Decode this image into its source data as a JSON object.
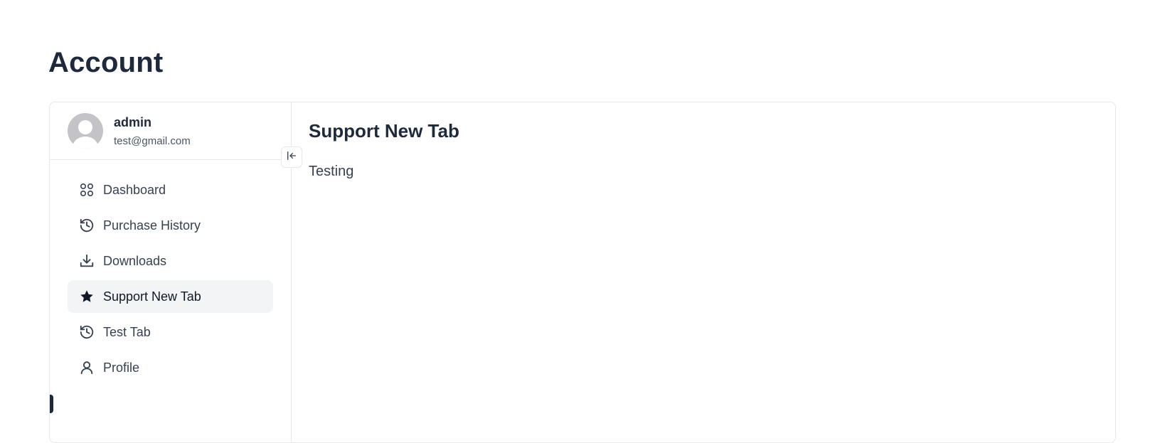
{
  "page": {
    "title": "Account"
  },
  "user": {
    "name": "admin",
    "email": "test@gmail.com"
  },
  "sidebar": {
    "collapse_icon": "collapse-left-icon",
    "items": [
      {
        "label": "Dashboard",
        "icon": "grid-icon",
        "active": false
      },
      {
        "label": "Purchase History",
        "icon": "history-icon",
        "active": false
      },
      {
        "label": "Downloads",
        "icon": "download-icon",
        "active": false
      },
      {
        "label": "Support New Tab",
        "icon": "star-icon",
        "active": true
      },
      {
        "label": "Test Tab",
        "icon": "history-icon",
        "active": false
      },
      {
        "label": "Profile",
        "icon": "user-icon",
        "active": false
      }
    ]
  },
  "content": {
    "title": "Support New Tab",
    "body": "Testing"
  },
  "colors": {
    "text_primary": "#1e293b",
    "border": "#e5e7eb",
    "active_bg": "#f3f4f6"
  }
}
